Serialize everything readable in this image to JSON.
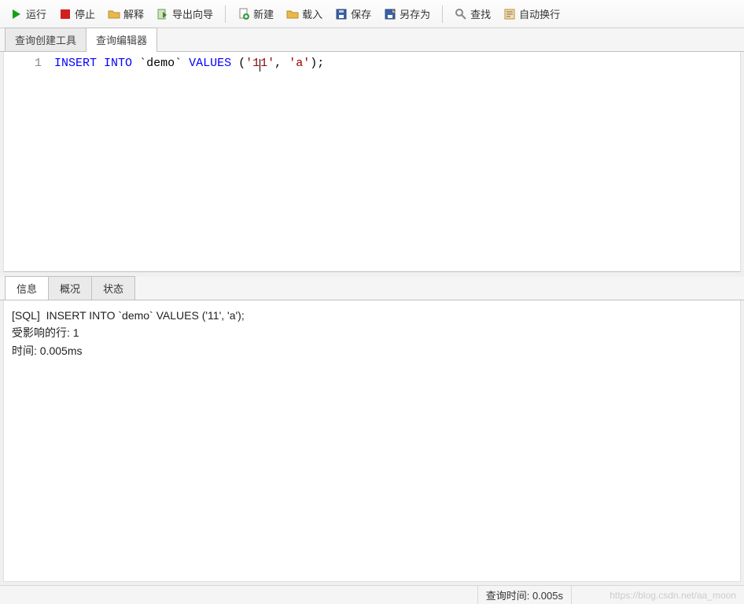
{
  "toolbar": {
    "run": "运行",
    "stop": "停止",
    "explain": "解释",
    "export_wizard": "导出向导",
    "new": "新建",
    "load": "载入",
    "save": "保存",
    "save_as": "另存为",
    "find": "查找",
    "wrap": "自动换行"
  },
  "editor_tabs": {
    "builder": "查询创建工具",
    "editor": "查询编辑器"
  },
  "code": {
    "line_no": "1",
    "kw_insert": "INSERT",
    "kw_into": "INTO",
    "ident_table": "`demo`",
    "kw_values": "VALUES",
    "paren_open": "(",
    "str1_a": "'1",
    "str1_b": "1'",
    "comma": ",",
    "str2": "'a'",
    "paren_close": ")",
    "semi": ";"
  },
  "result_tabs": {
    "info": "信息",
    "profile": "概况",
    "status": "状态"
  },
  "result": {
    "line1": "[SQL]  INSERT INTO `demo` VALUES ('11', 'a');",
    "line2": "受影响的行: 1",
    "line3": "时间: 0.005ms"
  },
  "status": {
    "query_time_label": "查询时间: 0.005s"
  },
  "watermark": "https://blog.csdn.net/aa_moon"
}
